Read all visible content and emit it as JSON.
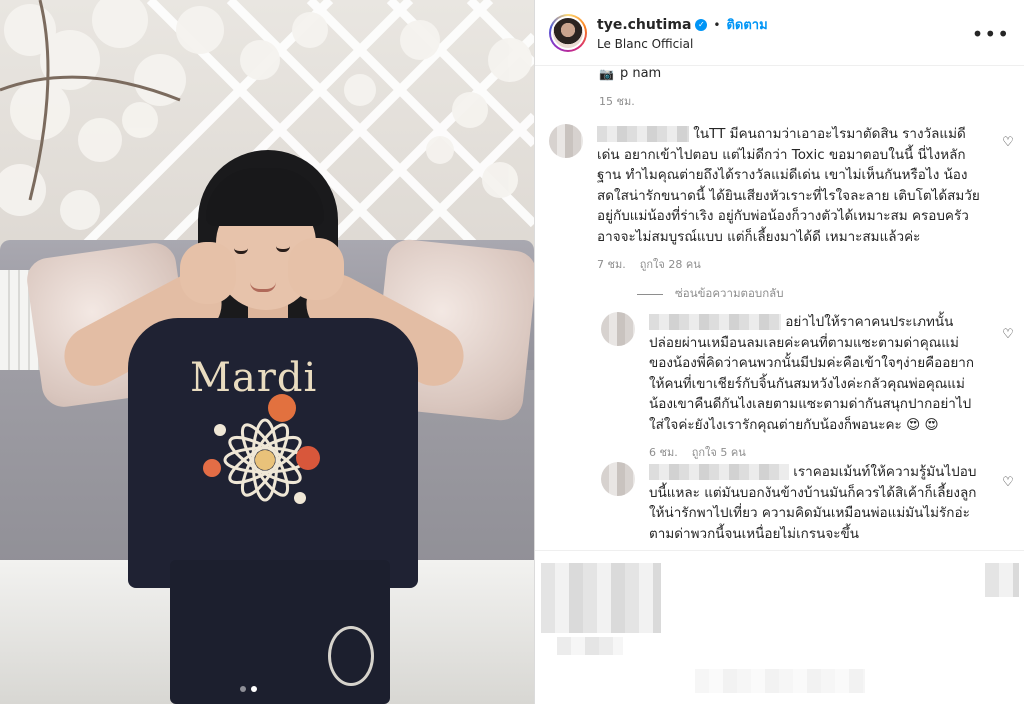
{
  "header": {
    "username": "tye.chutima",
    "separator": "•",
    "follow_label": "ติดตาม",
    "subtitle": "Le Blanc Official",
    "more_icon": "more-horizontal-icon"
  },
  "photo": {
    "shirt_text": "Mardi",
    "carousel_total": 2,
    "carousel_index": 2
  },
  "previous_comment": {
    "text": "p nam",
    "time": "15 ชม."
  },
  "comments": [
    {
      "text": "ในTT มีคนถามว่าเอาอะไรมาตัดสิน รางวัลแม่ดีเด่น อยากเข้าไปตอบ แต่ไม่ดีกว่า Toxic ขอมาตอบในนี้ นี่ไงหลักฐาน ทำไมคุณต่ายถึงได้รางวัลแม่ดีเด่น เขาไม่เห็นกันหรือไง น้องสดใสน่ารักขนาดนี้ ได้ยินเสียงหัวเราะที่ไรใจละลาย เติบโตได้สมวัยอยู่กับแม่น้องที่ร่าเริง อยู่กับพ่อน้องก็วางตัวได้เหมาะสม ครอบครัวอาจจะไม่สมบูรณ์แบบ แต่ก็เลี้ยงมาได้ดี เหมาะสมแล้วค่ะ",
      "time": "7 ชม.",
      "likes": "ถูกใจ 28 คน"
    }
  ],
  "replies_toggle": "ซ่อนข้อความตอบกลับ",
  "replies": [
    {
      "text": "อย่าไปให้ราคาคนประเภทนั้นปล่อยผ่านเหมือนลมเลยค่ะคนที่ตามแซะตามด่าคุณแม่ของน้องพี่คิดว่าคนพวกนั้นมีปมค่ะคือเข้าใจๆง่ายคืออยากให้คนที่เขาเชียร์กับจิ้นกันสมหวังไงค่ะกลัวคุณพ่อคุณแม่น้องเขาคืนดีกันไงเลยตามแซะตามด่ากันสนุกปากอย่าไปใส่ใจค่ะยังไงเรารักคุณต่ายกับน้องก็พอนะคะ",
      "emoji": "😍 😍",
      "time": "6 ชม.",
      "likes": "ถูกใจ 5 คน"
    },
    {
      "text": "เราคอมเม้นท์ให้ความรู้มันไปอบบนี้แหละ แต่มันบอกงันข้างบ้านมันก็ควรได้สิเค้าก็เลี้ยงลูกให้น่ารักพาไปเที่ยว ความคิดมันเหมือนพ่อแม่มันไม่รักอ่ะ ตามด่าพวกนี้จนเหนื่อยไม่เกรนจะขึ้น"
    }
  ],
  "colors": {
    "accent": "#0095f6",
    "meta": "#8e8e8e",
    "text": "#262626"
  }
}
